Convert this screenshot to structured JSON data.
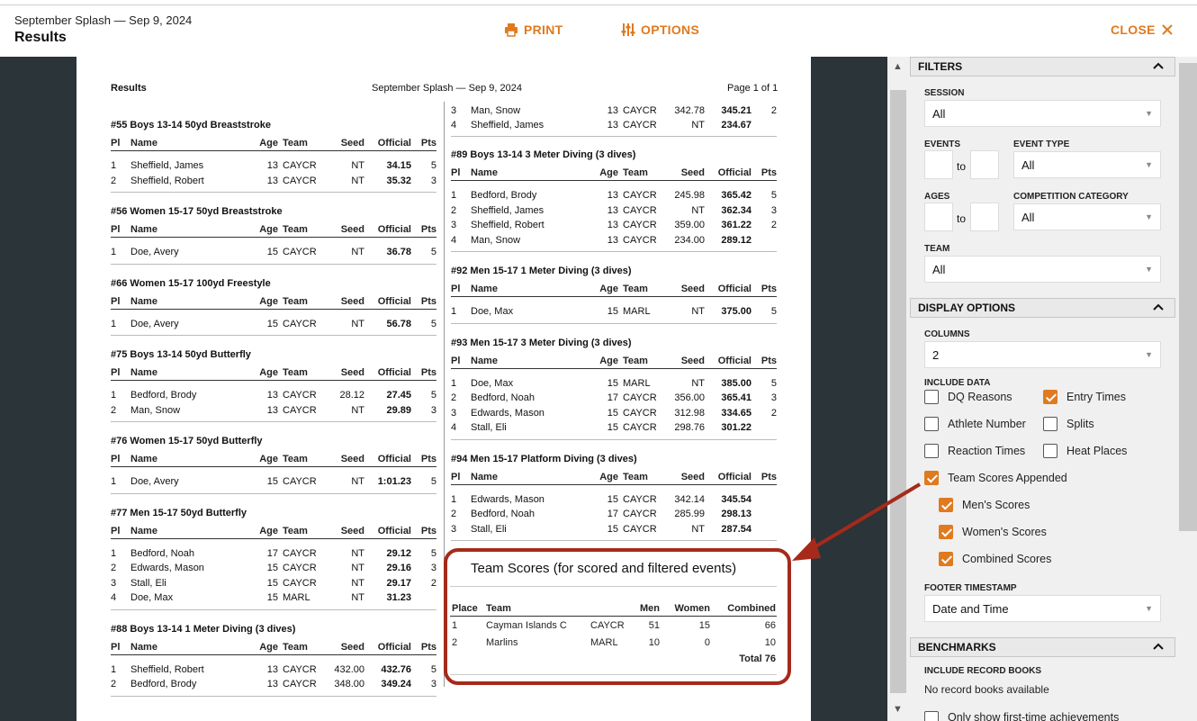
{
  "header": {
    "subtitle": "September Splash — Sep 9, 2024",
    "title": "Results",
    "print_label": "PRINT",
    "options_label": "OPTIONS",
    "close_label": "CLOSE"
  },
  "page": {
    "left_title": "Results",
    "center_title": "September Splash — Sep 9, 2024",
    "page_no": "Page 1 of 1",
    "headers": [
      "Pl",
      "Name",
      "Age",
      "Team",
      "Seed",
      "Official",
      "Pts"
    ]
  },
  "left_events": [
    {
      "title": "#55 Boys 13-14 50yd Breaststroke",
      "rows": [
        [
          "1",
          "Sheffield, James",
          "13",
          "CAYCR",
          "NT",
          "34.15",
          "5"
        ],
        [
          "2",
          "Sheffield, Robert",
          "13",
          "CAYCR",
          "NT",
          "35.32",
          "3"
        ]
      ]
    },
    {
      "title": "#56 Women 15-17 50yd Breaststroke",
      "rows": [
        [
          "1",
          "Doe, Avery",
          "15",
          "CAYCR",
          "NT",
          "36.78",
          "5"
        ]
      ]
    },
    {
      "title": "#66 Women 15-17 100yd Freestyle",
      "rows": [
        [
          "1",
          "Doe, Avery",
          "15",
          "CAYCR",
          "NT",
          "56.78",
          "5"
        ]
      ]
    },
    {
      "title": "#75 Boys 13-14 50yd Butterfly",
      "rows": [
        [
          "1",
          "Bedford, Brody",
          "13",
          "CAYCR",
          "28.12",
          "27.45",
          "5"
        ],
        [
          "2",
          "Man, Snow",
          "13",
          "CAYCR",
          "NT",
          "29.89",
          "3"
        ]
      ]
    },
    {
      "title": "#76 Women 15-17 50yd Butterfly",
      "rows": [
        [
          "1",
          "Doe, Avery",
          "15",
          "CAYCR",
          "NT",
          "1:01.23",
          "5"
        ]
      ]
    },
    {
      "title": "#77 Men 15-17 50yd Butterfly",
      "rows": [
        [
          "1",
          "Bedford, Noah",
          "17",
          "CAYCR",
          "NT",
          "29.12",
          "5"
        ],
        [
          "2",
          "Edwards, Mason",
          "15",
          "CAYCR",
          "NT",
          "29.16",
          "3"
        ],
        [
          "3",
          "Stall, Eli",
          "15",
          "CAYCR",
          "NT",
          "29.17",
          "2"
        ],
        [
          "4",
          "Doe, Max",
          "15",
          "MARL",
          "NT",
          "31.23",
          ""
        ]
      ]
    },
    {
      "title": "#88 Boys 13-14 1 Meter Diving (3 dives)",
      "rows": [
        [
          "1",
          "Sheffield, Robert",
          "13",
          "CAYCR",
          "432.00",
          "432.76",
          "5"
        ],
        [
          "2",
          "Bedford, Brody",
          "13",
          "CAYCR",
          "348.00",
          "349.24",
          "3"
        ]
      ]
    }
  ],
  "right_cont_rows": [
    [
      "3",
      "Man, Snow",
      "13",
      "CAYCR",
      "342.78",
      "345.21",
      "2"
    ],
    [
      "4",
      "Sheffield, James",
      "13",
      "CAYCR",
      "NT",
      "234.67",
      ""
    ]
  ],
  "right_events": [
    {
      "title": "#89 Boys 13-14 3 Meter Diving (3 dives)",
      "rows": [
        [
          "1",
          "Bedford, Brody",
          "13",
          "CAYCR",
          "245.98",
          "365.42",
          "5"
        ],
        [
          "2",
          "Sheffield, James",
          "13",
          "CAYCR",
          "NT",
          "362.34",
          "3"
        ],
        [
          "3",
          "Sheffield, Robert",
          "13",
          "CAYCR",
          "359.00",
          "361.22",
          "2"
        ],
        [
          "4",
          "Man, Snow",
          "13",
          "CAYCR",
          "234.00",
          "289.12",
          ""
        ]
      ]
    },
    {
      "title": "#92 Men 15-17 1 Meter Diving (3 dives)",
      "rows": [
        [
          "1",
          "Doe, Max",
          "15",
          "MARL",
          "NT",
          "375.00",
          "5"
        ]
      ]
    },
    {
      "title": "#93 Men 15-17 3 Meter Diving (3 dives)",
      "rows": [
        [
          "1",
          "Doe, Max",
          "15",
          "MARL",
          "NT",
          "385.00",
          "5"
        ],
        [
          "2",
          "Bedford, Noah",
          "17",
          "CAYCR",
          "356.00",
          "365.41",
          "3"
        ],
        [
          "3",
          "Edwards, Mason",
          "15",
          "CAYCR",
          "312.98",
          "334.65",
          "2"
        ],
        [
          "4",
          "Stall, Eli",
          "15",
          "CAYCR",
          "298.76",
          "301.22",
          ""
        ]
      ]
    },
    {
      "title": "#94 Men 15-17 Platform Diving (3 dives)",
      "rows": [
        [
          "1",
          "Edwards, Mason",
          "15",
          "CAYCR",
          "342.14",
          "345.54",
          ""
        ],
        [
          "2",
          "Bedford, Noah",
          "17",
          "CAYCR",
          "285.99",
          "298.13",
          ""
        ],
        [
          "3",
          "Stall, Eli",
          "15",
          "CAYCR",
          "NT",
          "287.54",
          ""
        ]
      ]
    }
  ],
  "team_scores": {
    "title": "Team Scores (for scored and filtered events)",
    "headers": [
      "Place",
      "Team",
      "Men",
      "Women",
      "Combined"
    ],
    "rows": [
      [
        "1",
        "Cayman Islands C",
        "CAYCR",
        "51",
        "15",
        "66"
      ],
      [
        "2",
        "Marlins",
        "MARL",
        "10",
        "0",
        "10"
      ]
    ],
    "total": "Total 76"
  },
  "panel": {
    "filters_title": "FILTERS",
    "session_label": "SESSION",
    "session_value": "All",
    "events_label": "EVENTS",
    "to_label": "to",
    "event_type_label": "EVENT TYPE",
    "event_type_value": "All",
    "ages_label": "AGES",
    "competition_label": "COMPETITION CATEGORY",
    "competition_value": "All",
    "team_label": "TEAM",
    "team_value": "All",
    "display_title": "DISPLAY OPTIONS",
    "columns_label": "COLUMNS",
    "columns_value": "2",
    "include_label": "INCLUDE DATA",
    "cb": {
      "dq": "DQ Reasons",
      "entry": "Entry Times",
      "athlete": "Athlete Number",
      "splits": "Splits",
      "reaction": "Reaction Times",
      "heat": "Heat Places",
      "team_scores": "Team Scores Appended",
      "mens": "Men's Scores",
      "womens": "Women's Scores",
      "combined": "Combined Scores"
    },
    "footer_label": "FOOTER TIMESTAMP",
    "footer_value": "Date and Time",
    "bench_title": "BENCHMARKS",
    "record_label": "INCLUDE RECORD BOOKS",
    "record_value": "No record books available",
    "first_time": "Only show first-time achievements"
  },
  "colors": {
    "accent": "#e07a1f",
    "highlight": "#a52a1a",
    "dark_bg": "#2b3438"
  }
}
